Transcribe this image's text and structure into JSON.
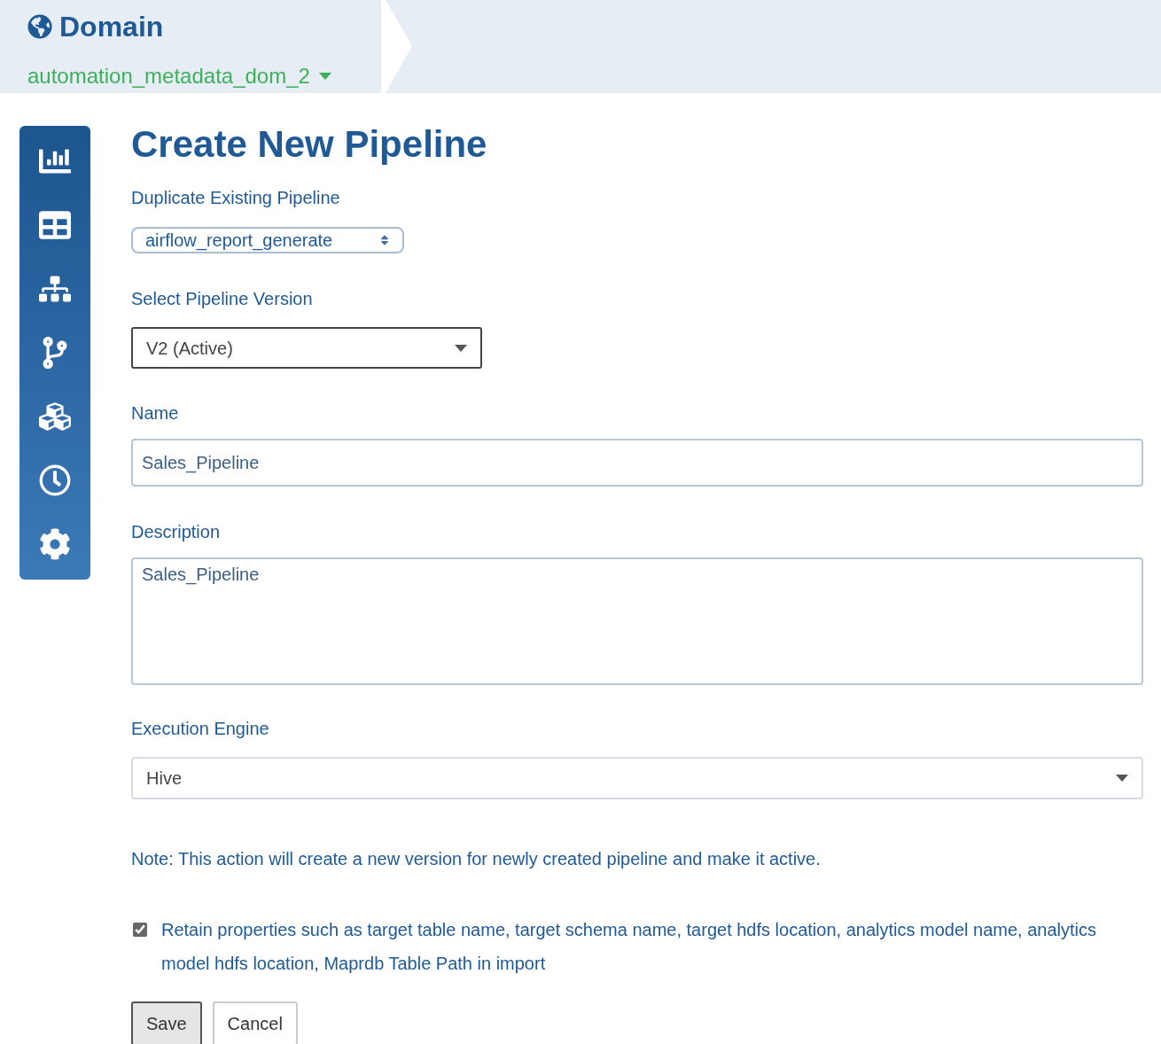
{
  "header": {
    "title": "Domain",
    "domain": "automation_metadata_dom_2"
  },
  "form": {
    "title": "Create New Pipeline",
    "duplicate": {
      "label": "Duplicate Existing Pipeline",
      "value": "airflow_report_generate"
    },
    "version": {
      "label": "Select Pipeline Version",
      "value": "V2 (Active)"
    },
    "name": {
      "label": "Name",
      "value": "Sales_Pipeline"
    },
    "description": {
      "label": "Description",
      "value": "Sales_Pipeline"
    },
    "engine": {
      "label": "Execution Engine",
      "value": "Hive"
    },
    "note": "Note: This action will create a new version for newly created pipeline and make it active.",
    "retain": {
      "label": "Retain properties such as target table name, target schema name, target hdfs location, analytics model name, analytics model hdfs location, Maprdb Table Path in import",
      "checked": true
    },
    "buttons": [
      "Save",
      "Cancel"
    ]
  }
}
